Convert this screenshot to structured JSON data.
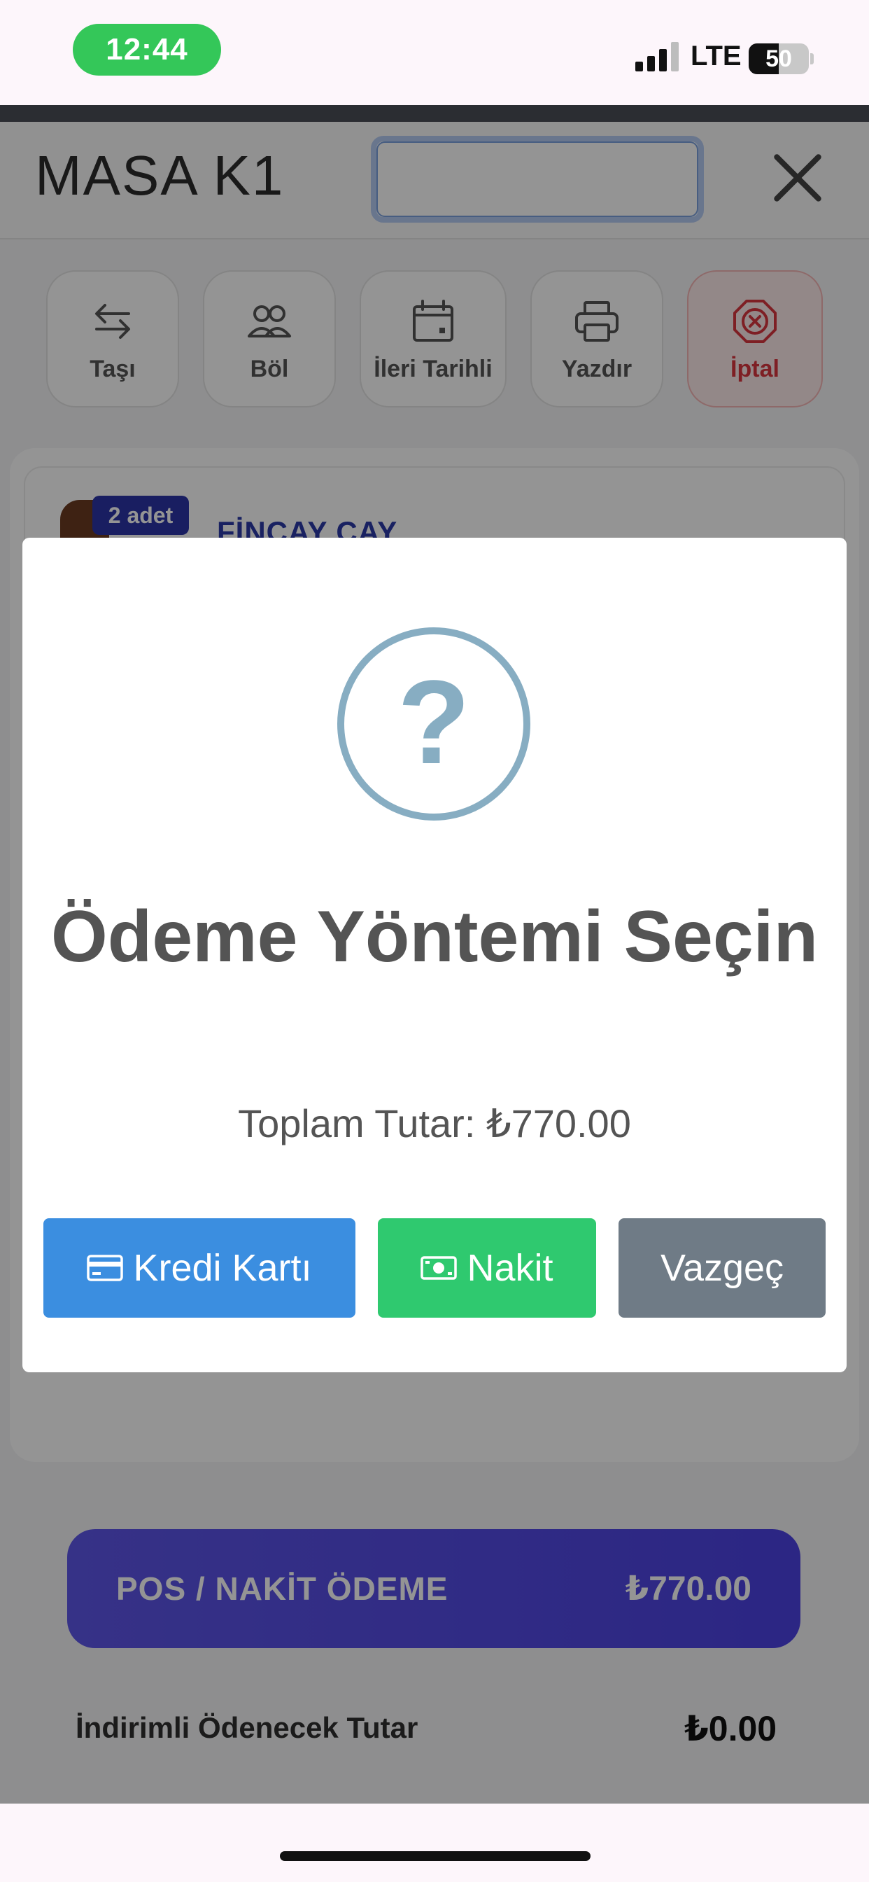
{
  "status_bar": {
    "time": "12:44",
    "network": "LTE",
    "battery": "50",
    "battery_level": 0.5
  },
  "header": {
    "title": "MASA K1",
    "search_value": "",
    "search_placeholder": ""
  },
  "actions": [
    {
      "label": "Taşı",
      "icon": "transfer-arrows-icon"
    },
    {
      "label": "Böl",
      "icon": "users-icon"
    },
    {
      "label": "İleri Tarihli",
      "icon": "calendar-icon"
    },
    {
      "label": "Yazdır",
      "icon": "printer-icon"
    },
    {
      "label": "İptal",
      "icon": "cancel-circle-icon"
    }
  ],
  "order_item": {
    "quantity": "2 adet",
    "name": "FİNCAY CAY"
  },
  "payment_button": {
    "label": "POS / NAKİT ÖDEME",
    "amount": "₺770.00"
  },
  "discount": {
    "label": "İndirimli Ödenecek Tutar",
    "amount": "₺0.00"
  },
  "modal": {
    "icon": "question-circle-icon",
    "title": "Ödeme Yöntemi Seçin",
    "total": "Toplam Tutar: ₺770.00",
    "buttons": [
      {
        "label": "Kredi Kartı",
        "icon": "credit-card-icon",
        "color": "#3b8ee0"
      },
      {
        "label": "Nakit",
        "icon": "cash-icon",
        "color": "#2fc96f"
      },
      {
        "label": "Vazgeç",
        "color": "#6f7b86"
      }
    ]
  },
  "colors": {
    "accent": "#5e56e8",
    "danger": "#d9363e",
    "success": "#34c759",
    "modal_icon": "#87adc2"
  }
}
